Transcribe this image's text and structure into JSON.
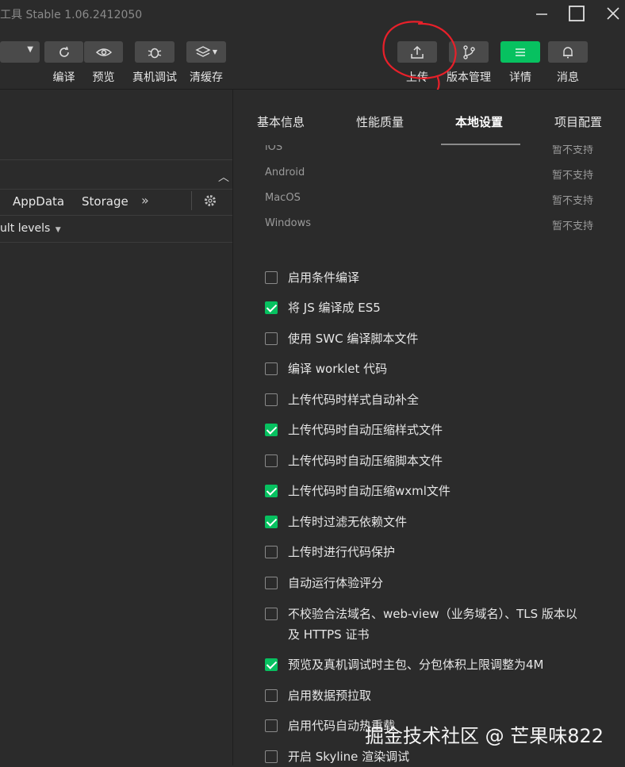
{
  "window": {
    "title": "工具 Stable 1.06.2412050"
  },
  "toolbar": {
    "left_buttons": [
      {
        "label": "编译",
        "icon": "refresh-icon"
      },
      {
        "label": "预览",
        "icon": "eye-icon"
      },
      {
        "label": "真机调试",
        "icon": "bug-icon"
      },
      {
        "label": "清缓存",
        "icon": "layers-icon"
      }
    ],
    "right_buttons": [
      {
        "label": "上传",
        "icon": "upload-icon"
      },
      {
        "label": "版本管理",
        "icon": "branch-icon"
      },
      {
        "label": "详情",
        "icon": "menu-icon"
      },
      {
        "label": "消息",
        "icon": "bell-icon"
      }
    ]
  },
  "devtools": {
    "tabs": [
      "AppData",
      "Storage"
    ],
    "more": "»",
    "filter": "ult levels"
  },
  "panel": {
    "tabs": [
      "基本信息",
      "性能质量",
      "本地设置",
      "项目配置"
    ],
    "active_tab": "本地设置",
    "systems": [
      {
        "name": "iOS",
        "status": "暂不支持"
      },
      {
        "name": "Android",
        "status": "暂不支持"
      },
      {
        "name": "MacOS",
        "status": "暂不支持"
      },
      {
        "name": "Windows",
        "status": "暂不支持"
      }
    ],
    "options": [
      {
        "label": "启用条件编译",
        "checked": false
      },
      {
        "label": "将 JS 编译成 ES5",
        "checked": true
      },
      {
        "label": "使用 SWC 编译脚本文件",
        "checked": false
      },
      {
        "label": "编译 worklet 代码",
        "checked": false
      },
      {
        "label": "上传代码时样式自动补全",
        "checked": false
      },
      {
        "label": "上传代码时自动压缩样式文件",
        "checked": true
      },
      {
        "label": "上传代码时自动压缩脚本文件",
        "checked": false
      },
      {
        "label": "上传代码时自动压缩wxml文件",
        "checked": true
      },
      {
        "label": "上传时过滤无依赖文件",
        "checked": true
      },
      {
        "label": "上传时进行代码保护",
        "checked": false
      },
      {
        "label": "自动运行体验评分",
        "checked": false
      },
      {
        "label": "不校验合法域名、web-view（业务域名）、TLS 版本以及 HTTPS 证书",
        "checked": false
      },
      {
        "label": "预览及真机调试时主包、分包体积上限调整为4M",
        "checked": true
      },
      {
        "label": "启用数据预拉取",
        "checked": false
      },
      {
        "label": "启用代码自动热重载",
        "checked": false
      },
      {
        "label": "开启 Skyline 渲染调试",
        "checked": false
      }
    ]
  },
  "watermark": "掘金技术社区 @ 芒果味822",
  "colors": {
    "accent": "#07c160",
    "bg": "#2b2b2b",
    "annotation": "#e8202a"
  }
}
